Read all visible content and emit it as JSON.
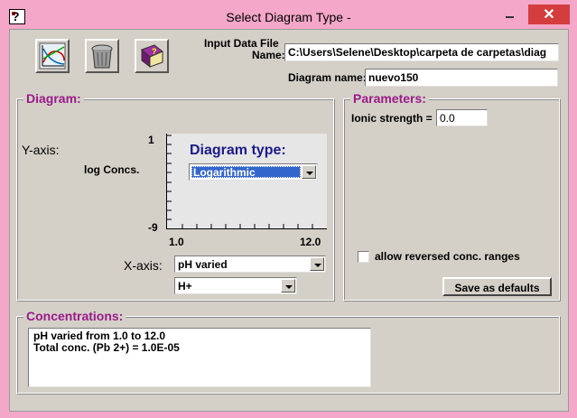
{
  "window": {
    "title": "Select Diagram Type  -",
    "icon": "help-icon",
    "min_icon": "minimize-icon",
    "max_icon": "maximize-icon",
    "close_icon": "close-icon",
    "close_glyph": "✕",
    "close_color": "#d43d3d",
    "frame_color": "#f4a7c8"
  },
  "toolbar": {
    "buttons": [
      {
        "icon": "plot-diagram-icon"
      },
      {
        "icon": "trash-can-icon"
      },
      {
        "icon": "help-book-icon"
      }
    ]
  },
  "file": {
    "label_line1": "Input Data File",
    "label_line2": "Name:",
    "value": "C:\\Users\\Selene\\Desktop\\carpeta de carpetas\\diag",
    "diagram_name_label": "Diagram name:",
    "diagram_name_value": "nuevo150"
  },
  "diagram": {
    "group_title": "Diagram:",
    "yaxis_label": "Y-axis:",
    "yaxis_value": "log Concs.",
    "y_max": "1",
    "y_min": "-9",
    "x_min": "1.0",
    "x_max": "12.0",
    "type_title": "Diagram type:",
    "type_value": "Logarithmic",
    "xaxis_label": "X-axis:",
    "xaxis_value": "pH varied",
    "xaxis_component": "H+"
  },
  "parameters": {
    "group_title": "Parameters:",
    "ionic_label": "Ionic strength =",
    "ionic_value": "0.0",
    "reversed_label": "allow reversed conc. ranges",
    "reversed_checked": false,
    "save_defaults_label": "Save as defaults"
  },
  "concentrations": {
    "group_title": "Concentrations:",
    "line1": "pH varied from  1.0 to  12.0",
    "line2": "Total conc. (Pb 2+) =  1.0E-05"
  },
  "colors": {
    "group_title": "#9b1a8a",
    "type_title": "#1a1a8a",
    "selection": "#3366cc"
  }
}
